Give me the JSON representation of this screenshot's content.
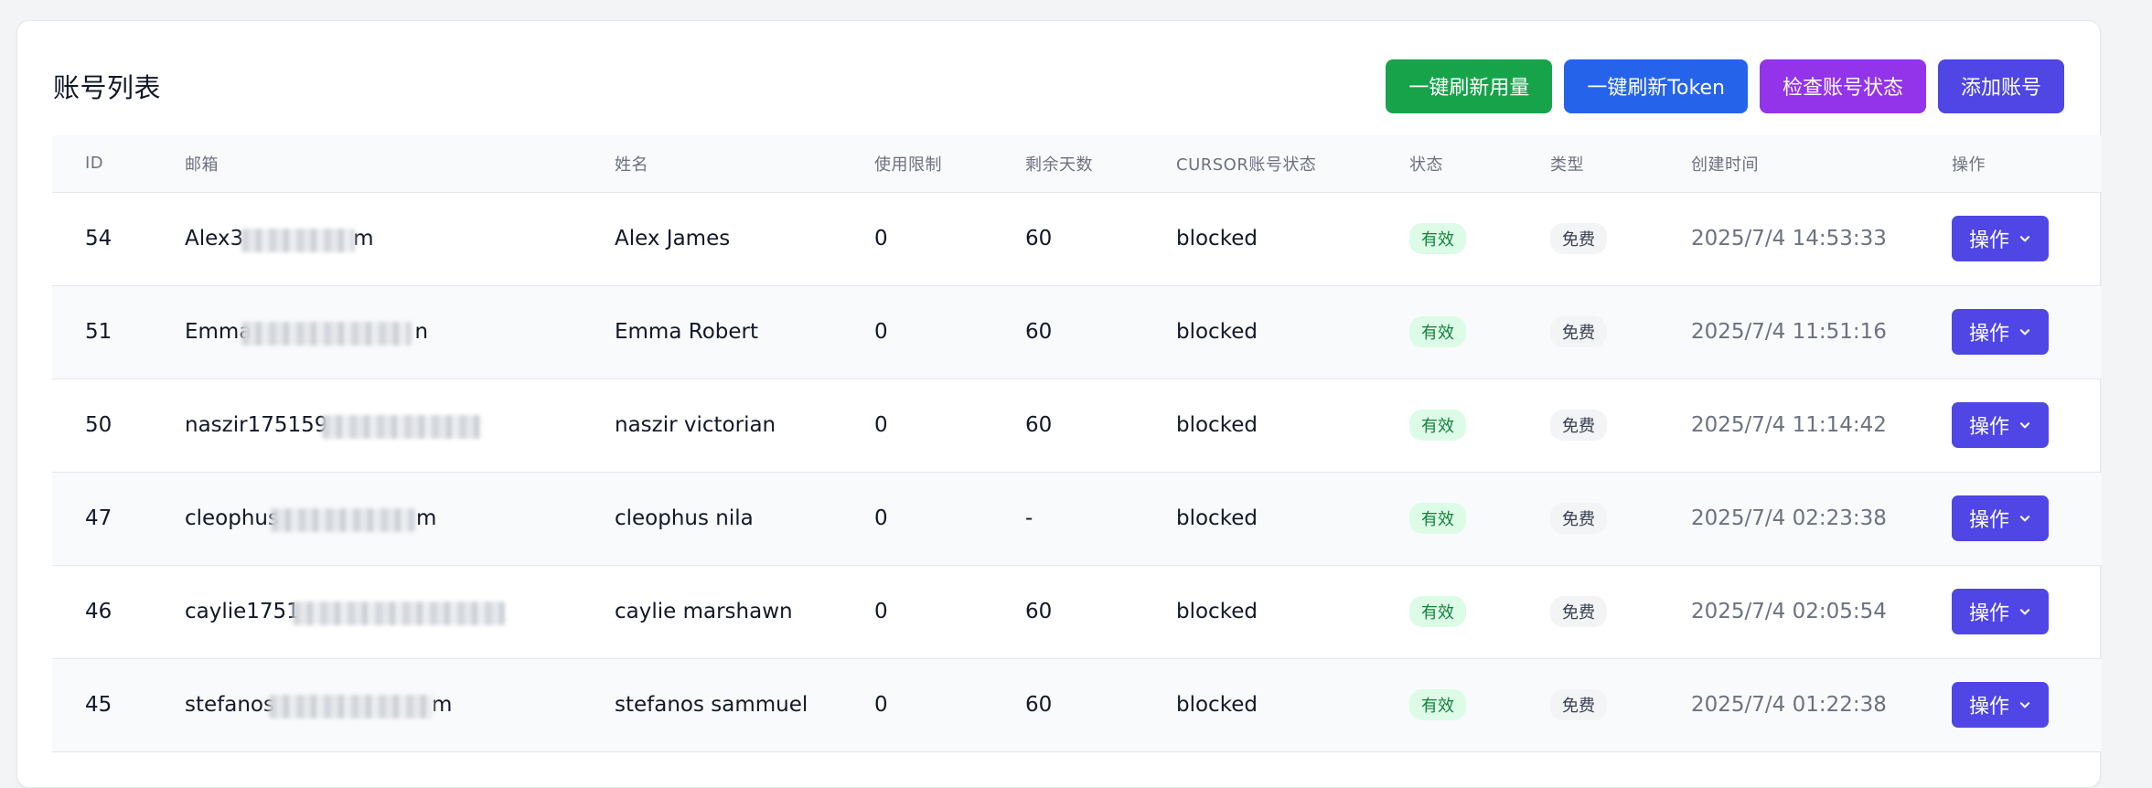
{
  "colors": {
    "green": "#16a34a",
    "blue": "#2563eb",
    "purple": "#9333ea",
    "indigo": "#4f46e5",
    "badge_valid_bg": "#dcfce7",
    "badge_valid_text": "#15803d"
  },
  "header": {
    "title": "账号列表",
    "buttons": {
      "refresh_usage": "一键刷新用量",
      "refresh_token": "一键刷新Token",
      "check_status": "检查账号状态",
      "add_account": "添加账号"
    }
  },
  "table": {
    "columns": [
      "ID",
      "邮箱",
      "姓名",
      "使用限制",
      "剩余天数",
      "CURSOR账号状态",
      "状态",
      "类型",
      "创建时间",
      "操作"
    ],
    "rows": [
      {
        "id": "54",
        "email_visible": "Alex3",
        "email_tail": "m",
        "name": "Alex James",
        "limit": "0",
        "days": "60",
        "cursor_status": "blocked",
        "status": "有效",
        "type": "免费",
        "created": "2025/7/4 14:53:33",
        "action": "操作"
      },
      {
        "id": "51",
        "email_visible": "Emma",
        "email_tail": "n",
        "name": "Emma Robert",
        "limit": "0",
        "days": "60",
        "cursor_status": "blocked",
        "status": "有效",
        "type": "免费",
        "created": "2025/7/4 11:51:16",
        "action": "操作"
      },
      {
        "id": "50",
        "email_visible": "naszir175159",
        "email_tail": "",
        "name": "naszir victorian",
        "limit": "0",
        "days": "60",
        "cursor_status": "blocked",
        "status": "有效",
        "type": "免费",
        "created": "2025/7/4 11:14:42",
        "action": "操作"
      },
      {
        "id": "47",
        "email_visible": "cleophus",
        "email_tail": "m",
        "name": "cleophus nila",
        "limit": "0",
        "days": "-",
        "cursor_status": "blocked",
        "status": "有效",
        "type": "免费",
        "created": "2025/7/4 02:23:38",
        "action": "操作"
      },
      {
        "id": "46",
        "email_visible": "caylie1751",
        "email_tail": "",
        "name": "caylie marshawn",
        "limit": "0",
        "days": "60",
        "cursor_status": "blocked",
        "status": "有效",
        "type": "免费",
        "created": "2025/7/4 02:05:54",
        "action": "操作"
      },
      {
        "id": "45",
        "email_visible": "stefanos",
        "email_tail": "m",
        "name": "stefanos sammuel",
        "limit": "0",
        "days": "60",
        "cursor_status": "blocked",
        "status": "有效",
        "type": "免费",
        "created": "2025/7/4 01:22:38",
        "action": "操作"
      }
    ]
  }
}
